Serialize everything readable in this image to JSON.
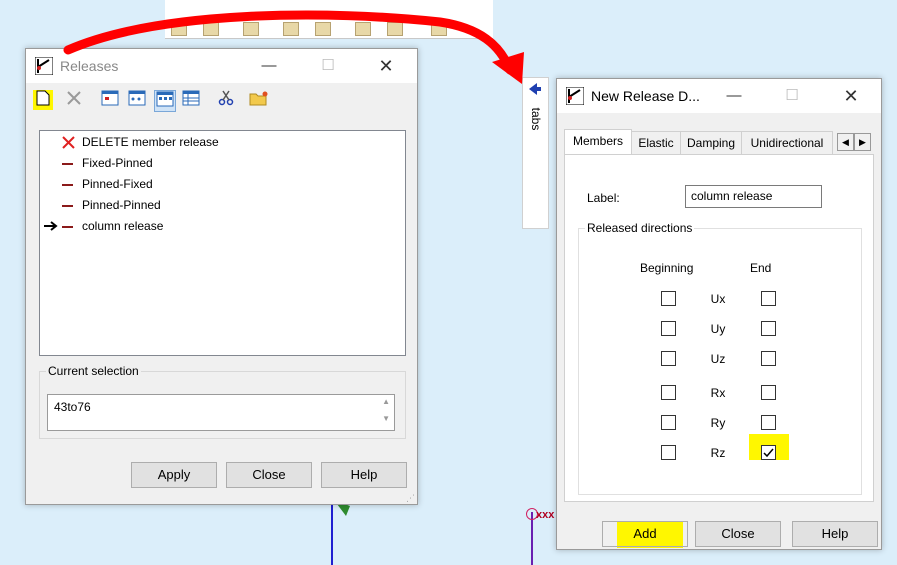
{
  "releases_window": {
    "title": "Releases",
    "list_items": [
      {
        "label": "DELETE member release",
        "icon": "x-icon"
      },
      {
        "label": "Fixed-Pinned",
        "icon": "dash-icon"
      },
      {
        "label": "Pinned-Fixed",
        "icon": "dash-icon"
      },
      {
        "label": "Pinned-Pinned",
        "icon": "dash-icon"
      },
      {
        "label": "column release",
        "icon": "dash-icon"
      }
    ],
    "current_selection_label": "Current selection",
    "current_selection_value": "43to76",
    "apply_label": "Apply",
    "close_label": "Close",
    "help_label": "Help"
  },
  "side_tab": {
    "label": "tabs"
  },
  "release_dialog": {
    "title": "New Release D...",
    "tabs": [
      "Members",
      "Elastic",
      "Damping",
      "Unidirectional"
    ],
    "label_field_label": "Label:",
    "label_field_value": "column release",
    "group_label": "Released directions",
    "beginning_label": "Beginning",
    "end_label": "End",
    "directions": [
      {
        "name": "Ux",
        "beginning": false,
        "end": false
      },
      {
        "name": "Uy",
        "beginning": false,
        "end": false
      },
      {
        "name": "Uz",
        "beginning": false,
        "end": false
      },
      {
        "name": "Rx",
        "beginning": false,
        "end": false
      },
      {
        "name": "Ry",
        "beginning": false,
        "end": false
      },
      {
        "name": "Rz",
        "beginning": false,
        "end": true
      }
    ],
    "add_label": "Add",
    "close_label": "Close",
    "help_label": "Help"
  },
  "canvas_label": "xxx",
  "colors": {
    "highlight": "#fff700",
    "annotation_arrow": "#ff0000",
    "member_line": "#1f1fd0",
    "release_dash": "#8b1a1a"
  }
}
